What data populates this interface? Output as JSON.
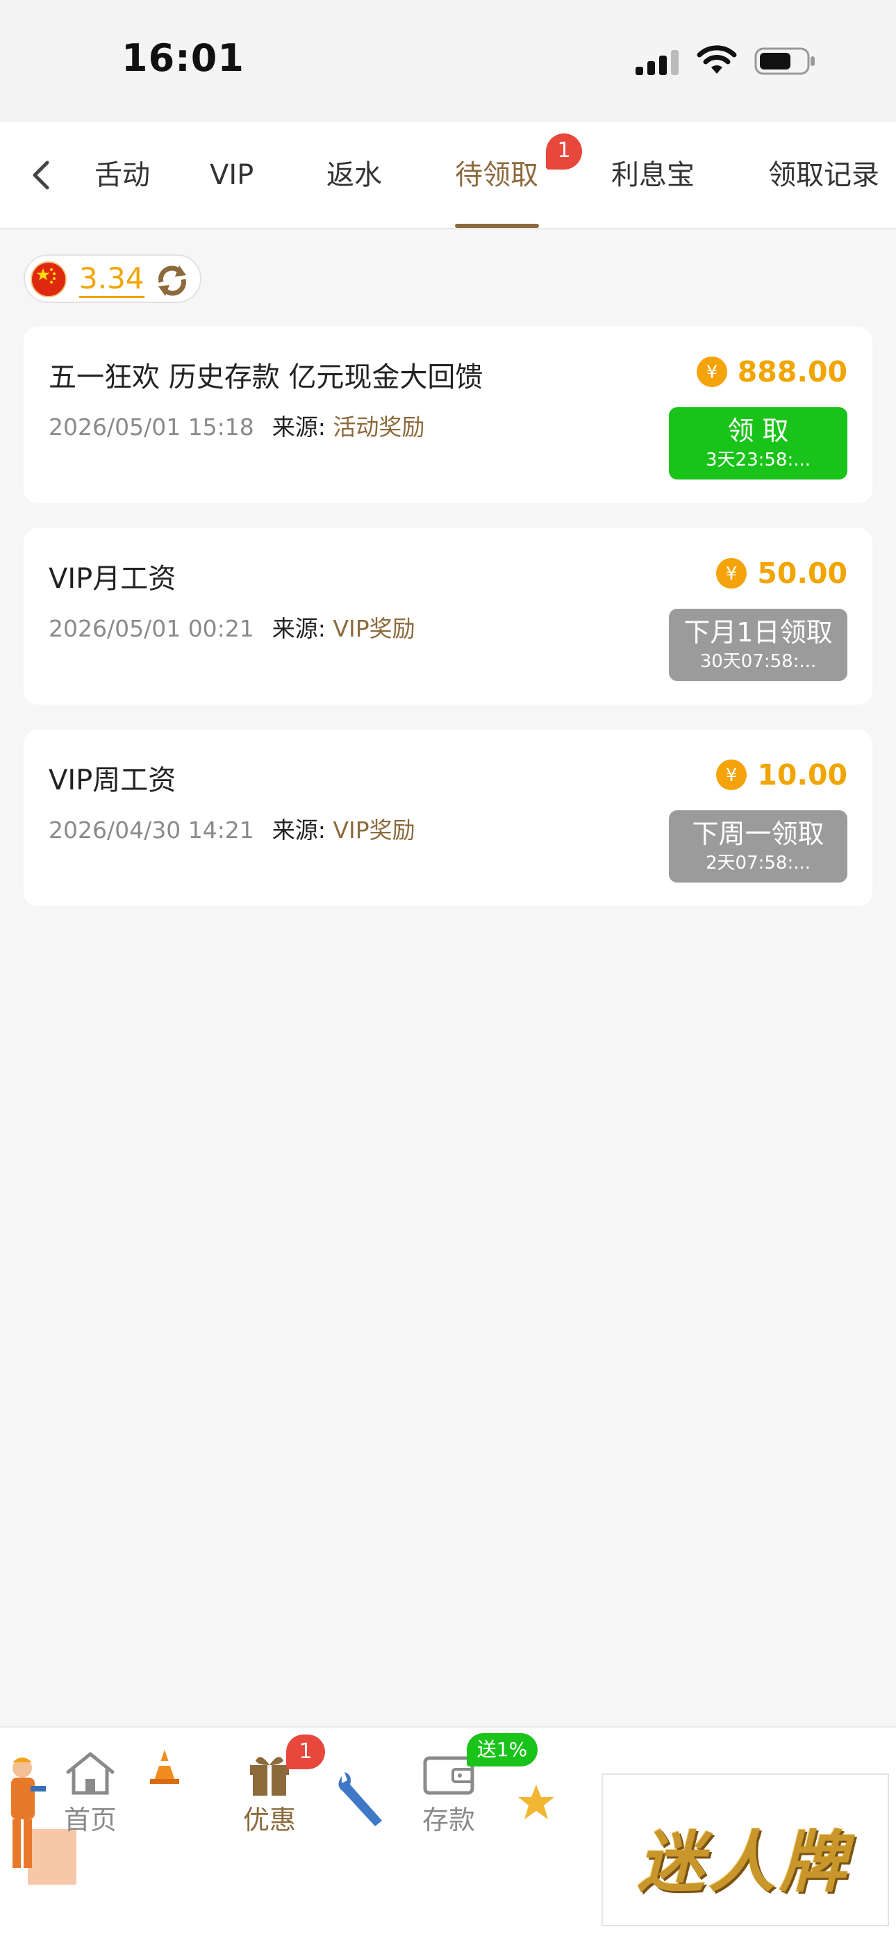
{
  "status_bar": {
    "time": "16:01"
  },
  "tabs": [
    {
      "label": "舌动"
    },
    {
      "label": "VIP"
    },
    {
      "label": "返水"
    },
    {
      "label": "待领取"
    },
    {
      "label": "利息宝"
    },
    {
      "label": "领取记录"
    }
  ],
  "active_tab_badge": "1",
  "balance": {
    "value": "3.34"
  },
  "rewards": [
    {
      "title": "五一狂欢 历史存款 亿元现金大回馈",
      "date": "2026/05/01 15:18",
      "source_label": "来源:",
      "source": "活动奖励",
      "amount": "888.00",
      "button_label": "领 取",
      "countdown": "3天23:58:...",
      "button_state": "available"
    },
    {
      "title": "VIP月工资",
      "date": "2026/05/01 00:21",
      "source_label": "来源:",
      "source": "VIP奖励",
      "amount": "50.00",
      "button_label": "下月1日领取",
      "countdown": "30天07:58:...",
      "button_state": "disabled"
    },
    {
      "title": "VIP周工资",
      "date": "2026/04/30 14:21",
      "source_label": "来源:",
      "source": "VIP奖励",
      "amount": "10.00",
      "button_label": "下周一领取",
      "countdown": "2天07:58:...",
      "button_state": "disabled"
    }
  ],
  "bottom_tabs": [
    {
      "label": "首页",
      "icon": "home-icon"
    },
    {
      "label": "优惠",
      "icon": "gift-icon"
    },
    {
      "label": "存款",
      "icon": "wallet-icon"
    }
  ],
  "bottom_badge": "1",
  "deposit_promo": "送1%",
  "ad": {
    "text": "迷人牌"
  },
  "colors": {
    "accent": "#8c6a3c",
    "gold": "#f0a500",
    "green": "#19c319",
    "badge": "#e8473c",
    "disabled": "#9b9b9b"
  }
}
